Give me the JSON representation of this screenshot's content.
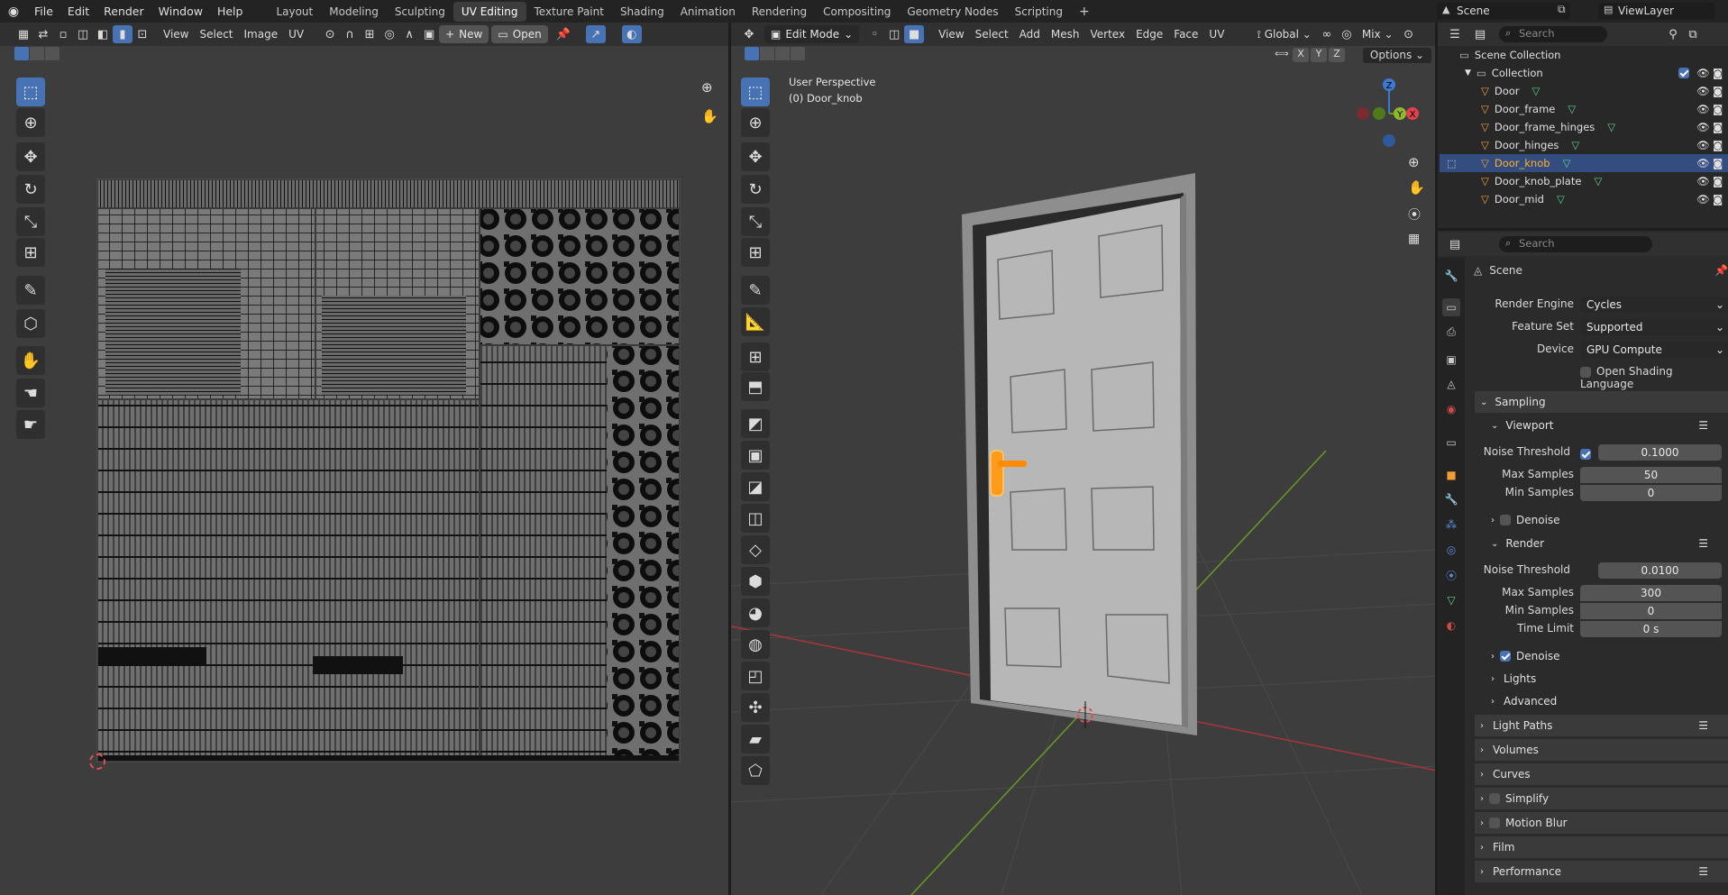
{
  "app": {
    "logo": "blender-icon"
  },
  "menus": [
    "File",
    "Edit",
    "Render",
    "Window",
    "Help"
  ],
  "workspaces": [
    "Layout",
    "Modeling",
    "Sculpting",
    "UV Editing",
    "Texture Paint",
    "Shading",
    "Animation",
    "Rendering",
    "Compositing",
    "Geometry Nodes",
    "Scripting"
  ],
  "active_workspace": "UV Editing",
  "scene_field": "Scene",
  "viewlayer_field": "ViewLayer",
  "uv_editor": {
    "menus": [
      "View",
      "Select",
      "Image",
      "UV"
    ],
    "new_label": "New",
    "open_label": "Open"
  },
  "viewport": {
    "mode": "Edit Mode",
    "menus": [
      "View",
      "Select",
      "Add",
      "Mesh",
      "Vertex",
      "Edge",
      "Face",
      "UV"
    ],
    "orientation": "Global",
    "shading": "Mix",
    "options_label": "Options",
    "axes": [
      "X",
      "Y",
      "Z"
    ],
    "overlay_title": "User Perspective",
    "overlay_object": "(0) Door_knob",
    "gizmo_axes": [
      "Z",
      "Y",
      "X"
    ]
  },
  "outliner": {
    "search_placeholder": "Search",
    "scene_collection": "Scene Collection",
    "collection": "Collection",
    "items": [
      "Door",
      "Door_frame",
      "Door_frame_hinges",
      "Door_hinges",
      "Door_knob",
      "Door_knob_plate",
      "Door_mid"
    ],
    "selected": "Door_knob"
  },
  "properties": {
    "search_placeholder": "Search",
    "context": "Scene",
    "render_engine_label": "Render Engine",
    "render_engine": "Cycles",
    "feature_set_label": "Feature Set",
    "feature_set": "Supported",
    "device_label": "Device",
    "device": "GPU Compute",
    "osl_label": "Open Shading Language",
    "sampling": "Sampling",
    "viewport_sub": "Viewport",
    "noise_threshold_label": "Noise Threshold",
    "viewport_noise": "0.1000",
    "max_samples_label": "Max Samples",
    "viewport_max": "50",
    "min_samples_label": "Min Samples",
    "viewport_min": "0",
    "denoise_label": "Denoise",
    "render_sub": "Render",
    "render_noise": "0.0100",
    "render_max": "300",
    "render_min": "0",
    "time_limit_label": "Time Limit",
    "time_limit": "0 s",
    "lights": "Lights",
    "advanced": "Advanced",
    "light_paths": "Light Paths",
    "volumes": "Volumes",
    "curves": "Curves",
    "simplify": "Simplify",
    "motion_blur": "Motion Blur",
    "film": "Film",
    "performance": "Performance"
  },
  "colors": {
    "accent": "#4772b3",
    "select_orange": "#ff8c00",
    "x_axis": "#a8363c",
    "y_axis": "#6a9a23",
    "z_axis": "#3a7ad0"
  }
}
